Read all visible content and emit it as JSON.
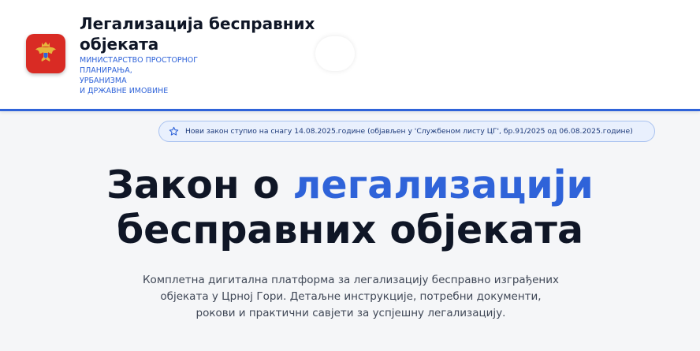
{
  "header": {
    "title": "Легализација бесправних објеката",
    "subtitle_lines": [
      "МИНИСТАРСТВО ПРОСТОРНОГ",
      "ПЛАНИРАЊА,",
      "УРБАНИЗМА",
      "И ДРЖАВНЕ ИМОВИНЕ"
    ],
    "logo_icon": "montenegro-coat-of-arms-icon",
    "accent_color": "#2f63d9",
    "logo_color": "#d92b24"
  },
  "notice": {
    "icon": "star-icon",
    "text": "Нови закон ступио на снагу 14.08.2025.године (објављен у 'Службеном листу ЦГ', бр.91/2025 од 06.08.2025.године)"
  },
  "hero": {
    "title_part1": "Закон о ",
    "title_accent": "легализацији",
    "title_part2": "бесправних објеката",
    "description": "Комплетна дигитална платформа за легализацију бесправно изграђених објеката у Црној Гори. Детаљне инструкције, потребни документи, рокови и практични савјети за успјешну легализацију."
  }
}
